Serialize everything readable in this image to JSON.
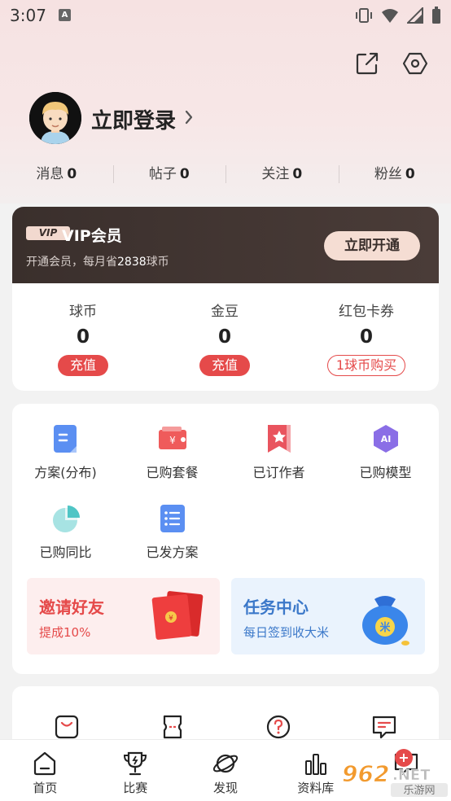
{
  "status_bar": {
    "time": "3:07",
    "notification_glyph": "A"
  },
  "profile": {
    "login_label": "立即登录"
  },
  "stats": [
    {
      "label": "消息",
      "value": "0"
    },
    {
      "label": "帖子",
      "value": "0"
    },
    {
      "label": "关注",
      "value": "0"
    },
    {
      "label": "粉丝",
      "value": "0"
    }
  ],
  "vip": {
    "badge": "VIP",
    "title": "VIP会员",
    "subtitle_prefix": "开通会员，每月省",
    "subtitle_amount": "2838",
    "subtitle_suffix": "球币",
    "button": "立即开通"
  },
  "wallet": [
    {
      "label": "球币",
      "value": "0",
      "action": "充值"
    },
    {
      "label": "金豆",
      "value": "0",
      "action": "充值"
    },
    {
      "label": "红包卡券",
      "value": "0",
      "action": "1球币购买"
    }
  ],
  "services": [
    {
      "label": "方案(分布)",
      "icon": "plan-icon"
    },
    {
      "label": "已购套餐",
      "icon": "package-icon"
    },
    {
      "label": "已订作者",
      "icon": "subscribed-author-icon"
    },
    {
      "label": "已购模型",
      "icon": "ai-model-icon"
    },
    {
      "label": "已购同比",
      "icon": "pie-chart-icon"
    },
    {
      "label": "已发方案",
      "icon": "published-plan-icon"
    }
  ],
  "promos": {
    "invite": {
      "title": "邀请好友",
      "subtitle": "提成10%"
    },
    "tasks": {
      "title": "任务中心",
      "subtitle": "每日签到收大米"
    }
  },
  "bottom_nav": [
    {
      "label": "首页",
      "icon": "home-icon"
    },
    {
      "label": "比赛",
      "icon": "trophy-icon"
    },
    {
      "label": "发现",
      "icon": "planet-icon"
    },
    {
      "label": "资料库",
      "icon": "bar-chart-icon"
    },
    {
      "label": "",
      "icon": "message-icon"
    }
  ],
  "nav_badge": "+",
  "watermark": {
    "brand": "962",
    "domain": ".NET",
    "tagline": "乐游网"
  },
  "colors": {
    "accent": "#e54a4a",
    "vip_dark": "#3a2f2c",
    "vip_button": "#f5ddd3"
  }
}
